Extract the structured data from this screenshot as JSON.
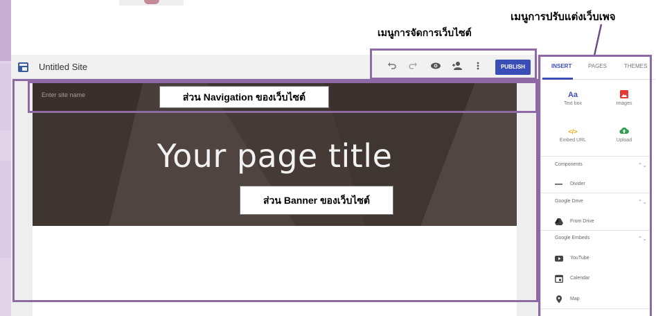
{
  "annotations": {
    "page_customize_menu": "เมนูการปรับแต่งเว็บเพจ",
    "site_management_menu": "เมนูการจัดการเว็บไซต์",
    "navigation_section": "ส่วน Navigation ของเว็บไซต์",
    "banner_section": "ส่วน Banner ของเว็บไซต์"
  },
  "toolbar": {
    "site_title": "Untitled Site",
    "publish_label": "PUBLISH"
  },
  "page": {
    "site_name_placeholder": "Enter site name",
    "title": "Your page title"
  },
  "panel": {
    "tabs": [
      {
        "label": "INSERT",
        "active": true
      },
      {
        "label": "PAGES",
        "active": false
      },
      {
        "label": "THEMES",
        "active": false
      }
    ],
    "insert_items": [
      {
        "label": "Text box",
        "icon": "text-box-icon",
        "glyph": "Aa",
        "color": "#3b4eb8"
      },
      {
        "label": "Images",
        "icon": "image-icon",
        "color": "#e53935"
      },
      {
        "label": "Embed URL",
        "icon": "embed-code-icon",
        "glyph": "</>",
        "color": "#f4a300"
      },
      {
        "label": "Upload",
        "icon": "cloud-upload-icon",
        "color": "#2e9e4f"
      }
    ],
    "sections": [
      {
        "title": "Components",
        "items": [
          {
            "label": "Divider",
            "icon": "divider-icon"
          }
        ]
      },
      {
        "title": "Google Drive",
        "items": [
          {
            "label": "From Drive",
            "icon": "drive-icon"
          }
        ]
      },
      {
        "title": "Google Embeds",
        "items": [
          {
            "label": "YouTube",
            "icon": "youtube-icon"
          },
          {
            "label": "Calendar",
            "icon": "calendar-icon"
          },
          {
            "label": "Map",
            "icon": "map-pin-icon"
          }
        ]
      }
    ]
  },
  "colors": {
    "accent": "#3b4eb8",
    "annotation_frame": "#8e6aa5",
    "banner": "#463b36"
  }
}
